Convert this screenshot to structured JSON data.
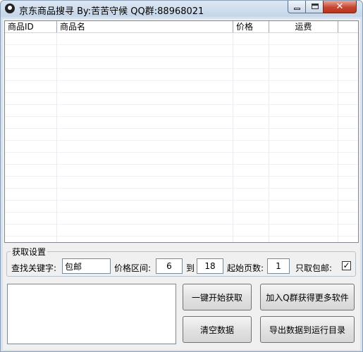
{
  "window": {
    "title": "京东商品搜寻 By:苦苦守候 QQ群:88968021",
    "close_glyph": "✕"
  },
  "list": {
    "columns": [
      "商品ID",
      "商品名",
      "价格",
      "运费"
    ],
    "rows": []
  },
  "settings": {
    "group_title": "获取设置",
    "keyword_label": "查找关键字:",
    "keyword_value": "包邮",
    "price_range_label": "价格区间:",
    "price_min": "6",
    "to_label": "到",
    "price_max": "18",
    "start_page_label": "起始页数:",
    "start_page": "1",
    "free_shipping_label": "只取包邮:",
    "free_shipping_checked": true,
    "check_glyph": "✓"
  },
  "buttons": {
    "start": "一键开始获取",
    "join_group": "加入Q群获得更多软件",
    "clear": "清空数据",
    "export": "导出数据到运行目录"
  },
  "log": {
    "value": ""
  }
}
